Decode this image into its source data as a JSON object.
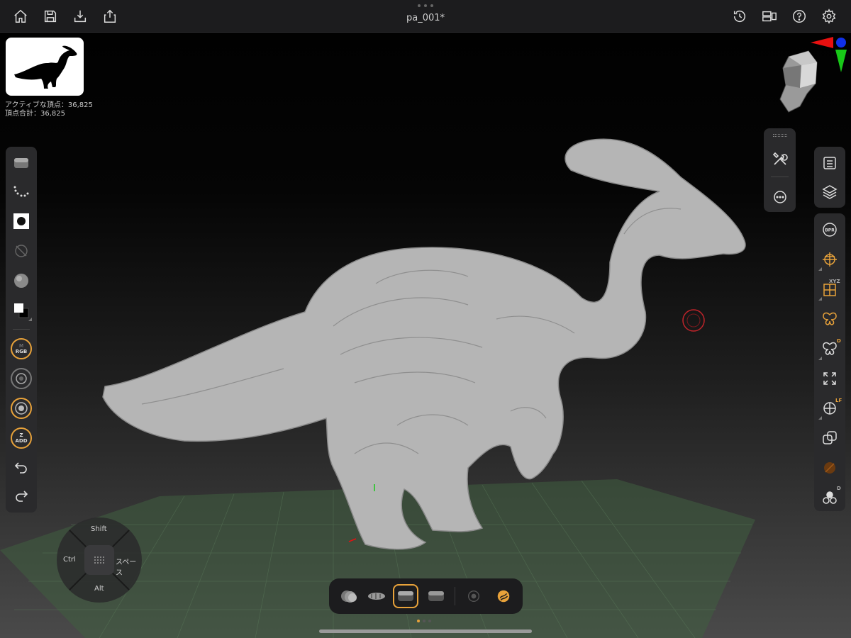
{
  "document": {
    "title": "pa_001*"
  },
  "stats": {
    "active_vertices": "アクティブな頂点：36,825",
    "total_vertices": "頂点合計：36,825"
  },
  "toolbar": {
    "left_icons": [
      "home-icon",
      "save-icon",
      "import-icon",
      "share-icon"
    ],
    "right_icons": [
      "history-icon",
      "layout-icon",
      "help-icon",
      "settings-icon"
    ]
  },
  "left_panel": {
    "color_ring_label_top": "M",
    "color_ring_label": "RGB",
    "stroke_ring_label_top": "Z",
    "stroke_ring_label": "ADD"
  },
  "right_panel": {
    "bpr_label": "BPR",
    "xyz_badge": "XYZ",
    "d_badge": "D",
    "lf_badge": "LF",
    "d_badge_2": "D"
  },
  "modifier_pad": {
    "top": "Shift",
    "left": "Ctrl",
    "right": "スペース",
    "bottom": "Alt"
  },
  "dock": {
    "selected_index": 2,
    "page_count": 3,
    "current_page": 1
  },
  "colors": {
    "accent": "#e8a23a",
    "panel": "#2a2a2c",
    "topbar": "#1c1c1e",
    "grid": "#3d5a3d",
    "model": "#b8b8b8"
  }
}
